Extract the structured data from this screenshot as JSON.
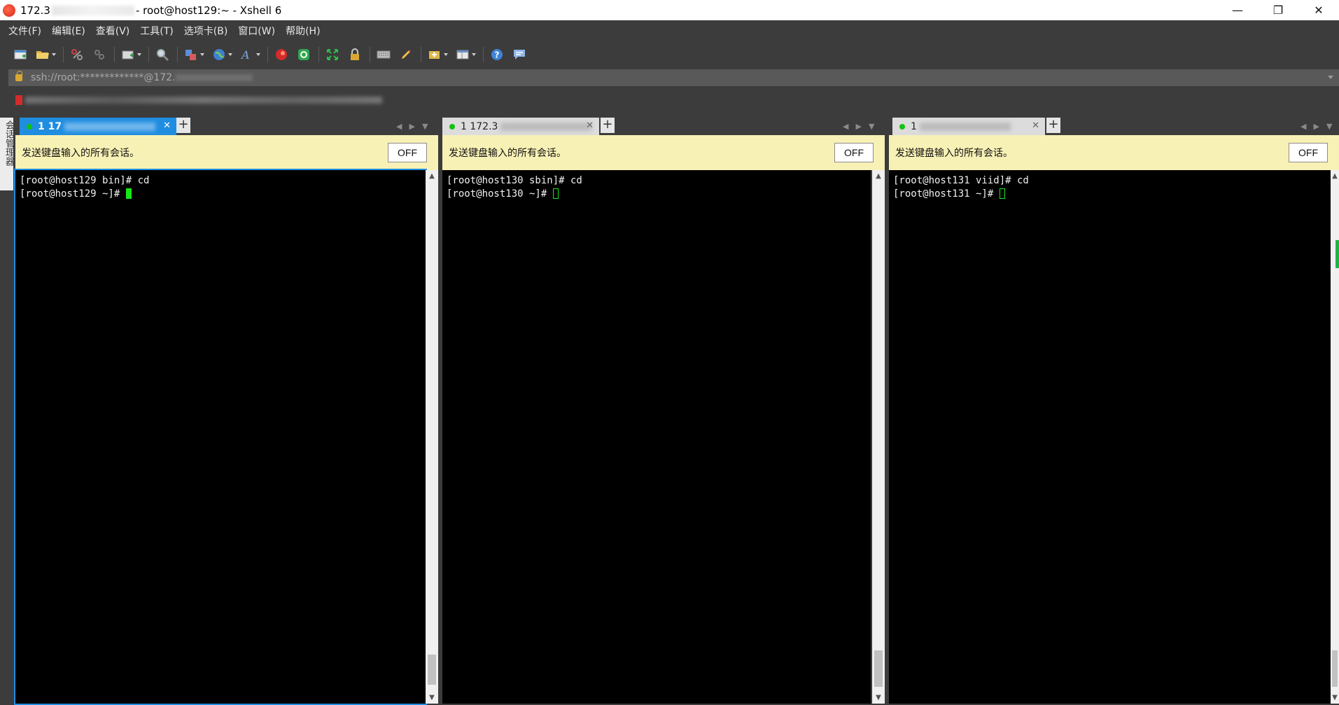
{
  "window": {
    "title_prefix": "172.3",
    "title_suffix": "- root@host129:~ - Xshell 6",
    "minimize": "—",
    "restore": "❐",
    "close": "✕"
  },
  "menu": [
    "文件(F)",
    "编辑(E)",
    "查看(V)",
    "工具(T)",
    "选项卡(B)",
    "窗口(W)",
    "帮助(H)"
  ],
  "address": {
    "text": "ssh://root:*************@172."
  },
  "sidebar": {
    "label": "会话管理器"
  },
  "broadcast": {
    "message": "发送键盘输入的所有会话。",
    "button": "OFF"
  },
  "panes": [
    {
      "tab_label": "1 17",
      "tab_active": true,
      "lines": [
        "[root@host129 bin]# cd",
        "[root@host129 ~]# "
      ]
    },
    {
      "tab_label": "1 172.3",
      "tab_active": false,
      "lines": [
        "[root@host130 sbin]# cd",
        "[root@host130 ~]# "
      ]
    },
    {
      "tab_label": "1 ",
      "tab_active": false,
      "lines": [
        "[root@host131 viid]# cd",
        "[root@host131 ~]# "
      ]
    }
  ],
  "colors": {
    "chrome": "#3c3c3c",
    "active_tab": "#1f8de0",
    "broadcast_bg": "#f8f1b5",
    "cursor": "#16e816",
    "session_dot": "#12c212"
  },
  "icons": [
    "new-session-icon",
    "open-folder-icon",
    "connect-icon",
    "disconnect-icon",
    "new-tab-icon",
    "find-icon",
    "transfer-icon",
    "globe-icon",
    "font-icon",
    "xftp-icon",
    "xmanager-icon",
    "fullscreen-icon",
    "lock-icon",
    "keyboard-icon",
    "highlight-icon",
    "compose-icon",
    "layout-icon",
    "help-icon",
    "chat-icon"
  ]
}
